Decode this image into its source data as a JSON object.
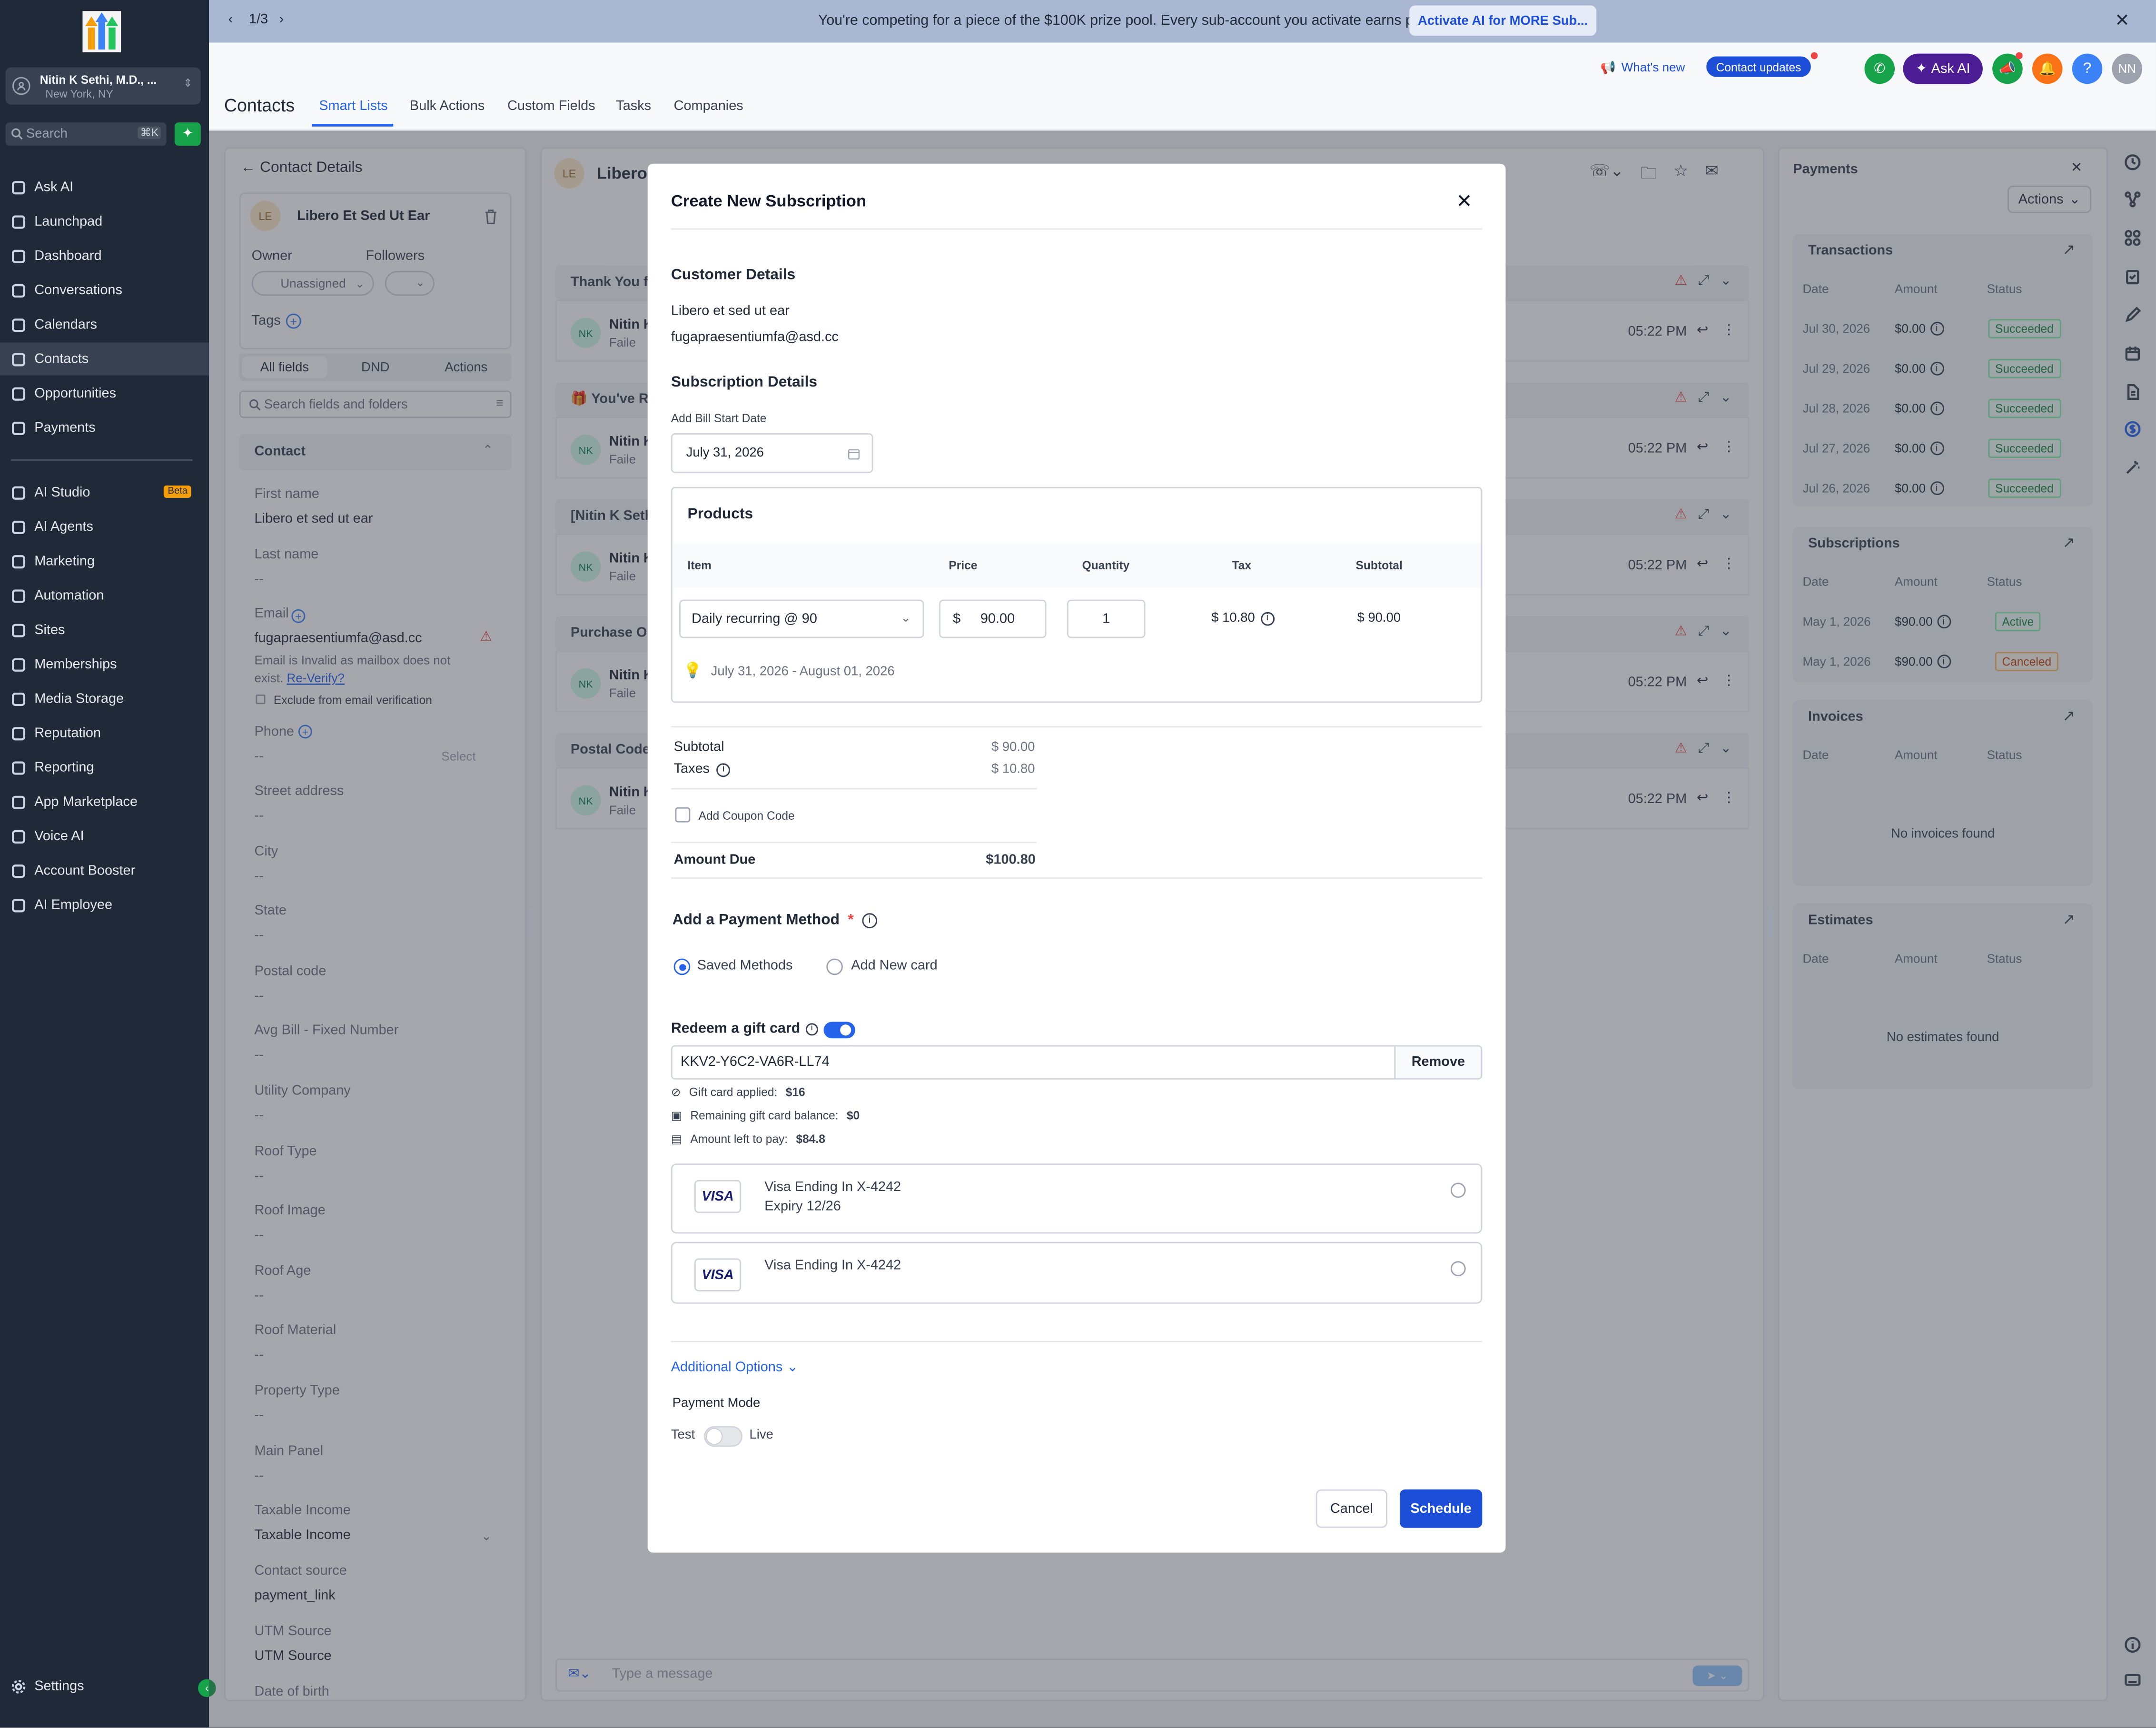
{
  "banner": {
    "page": "1/3",
    "message": "You're competing for a piece of the $100K prize pool. Every sub-account you activate earns points.",
    "cta": "Activate AI for MORE Sub..."
  },
  "account": {
    "name": "Nitin K Sethi, M.D., ...",
    "location": "New York, NY"
  },
  "search": {
    "placeholder": "Search",
    "shortcut": "⌘K"
  },
  "nav": [
    "Ask AI",
    "Launchpad",
    "Dashboard",
    "Conversations",
    "Calendars",
    "Contacts",
    "Opportunities",
    "Payments",
    "AI Studio",
    "AI Agents",
    "Marketing",
    "Automation",
    "Sites",
    "Memberships",
    "Media Storage",
    "Reputation",
    "Reporting",
    "App Marketplace",
    "Voice AI",
    "Account Booster",
    "AI Employee"
  ],
  "nav_badge": "Beta",
  "settings": "Settings",
  "header": {
    "whats_new": "What's new",
    "contact_updates": "Contact updates",
    "ask_ai": "Ask AI",
    "avatar": "NN",
    "title": "Contacts",
    "tabs": [
      "Smart Lists",
      "Bulk Actions",
      "Custom Fields",
      "Tasks",
      "Companies"
    ]
  },
  "contact": {
    "header": "Contact Details",
    "initials": "LE",
    "name": "Libero Et Sed Ut Ear",
    "owner_label": "Owner",
    "followers_label": "Followers",
    "owner_value": "Unassigned",
    "tags_label": "Tags",
    "subtabs": [
      "All fields",
      "DND",
      "Actions"
    ],
    "search_placeholder": "Search fields and folders",
    "section": "Contact",
    "fields": [
      {
        "label": "First name",
        "value": "Libero et sed ut ear"
      },
      {
        "label": "Last name",
        "value": "--"
      },
      {
        "label": "Email",
        "value": "fugapraesentiumfa@asd.cc"
      },
      {
        "label": "Phone",
        "value": "--"
      },
      {
        "label": "Street address",
        "value": "--"
      },
      {
        "label": "City",
        "value": "--"
      },
      {
        "label": "State",
        "value": "--"
      },
      {
        "label": "Postal code",
        "value": "--"
      },
      {
        "label": "Avg Bill - Fixed Number",
        "value": "--"
      },
      {
        "label": "Utility Company",
        "value": "--"
      },
      {
        "label": "Roof Type",
        "value": "--"
      },
      {
        "label": "Roof Image",
        "value": "--"
      },
      {
        "label": "Roof Age",
        "value": "--"
      },
      {
        "label": "Roof Material",
        "value": "--"
      },
      {
        "label": "Property Type",
        "value": "--"
      },
      {
        "label": "Main Panel",
        "value": "--"
      },
      {
        "label": "Taxable Income",
        "value": "Taxable Income"
      },
      {
        "label": "Contact source",
        "value": "payment_link"
      },
      {
        "label": "UTM Source",
        "value": "UTM Source"
      },
      {
        "label": "Date of birth",
        "value": ""
      }
    ],
    "email_warning": "Email is Invalid as mailbox does not exist.",
    "reverify": "Re-Verify?",
    "exclude": "Exclude from email verification",
    "phone_select": "Select"
  },
  "conversation": {
    "initials": "LE",
    "name": "Libero",
    "threads": [
      {
        "title": "Thank You fo",
        "who": "Nitin K",
        "status": "Faile",
        "time": "05:22 PM"
      },
      {
        "title": "🎁 You've Re",
        "who": "Nitin K",
        "status": "Faile",
        "time": "05:22 PM"
      },
      {
        "title": "[Nitin K Seth",
        "who": "Nitin K",
        "status": "Faile",
        "time": "05:22 PM"
      },
      {
        "title": "Purchase Or",
        "who": "Nitin K",
        "status": "Faile",
        "time": "05:22 PM"
      },
      {
        "title": "Postal Code",
        "who": "Nitin K",
        "status": "Faile",
        "time": "05:22 PM"
      }
    ],
    "avatar": "NK",
    "message_placeholder": "Type a message"
  },
  "payments": {
    "title": "Payments",
    "actions": "Actions",
    "transactions": {
      "title": "Transactions",
      "cols": [
        "Date",
        "Amount",
        "Status"
      ],
      "rows": [
        [
          "Jul 30, 2026",
          "$0.00",
          "Succeeded"
        ],
        [
          "Jul 29, 2026",
          "$0.00",
          "Succeeded"
        ],
        [
          "Jul 28, 2026",
          "$0.00",
          "Succeeded"
        ],
        [
          "Jul 27, 2026",
          "$0.00",
          "Succeeded"
        ],
        [
          "Jul 26, 2026",
          "$0.00",
          "Succeeded"
        ]
      ]
    },
    "subscriptions": {
      "title": "Subscriptions",
      "cols": [
        "Date",
        "Amount",
        "Status"
      ],
      "rows": [
        [
          "May 1, 2026",
          "$90.00",
          "Active"
        ],
        [
          "May 1, 2026",
          "$90.00",
          "Canceled"
        ]
      ]
    },
    "invoices": {
      "title": "Invoices",
      "cols": [
        "Date",
        "Amount",
        "Status"
      ],
      "empty": "No invoices found"
    },
    "estimates": {
      "title": "Estimates",
      "cols": [
        "Date",
        "Amount",
        "Status"
      ],
      "empty": "No estimates found"
    }
  },
  "modal": {
    "title": "Create New Subscription",
    "customer_heading": "Customer Details",
    "customer_name": "Libero et sed ut ear",
    "customer_email": "fugapraesentiumfa@asd.cc",
    "subscription_heading": "Subscription Details",
    "start_label": "Add Bill Start Date",
    "start_date": "July 31, 2026",
    "products_heading": "Products",
    "cols": [
      "Item",
      "Price",
      "Quantity",
      "Tax",
      "Subtotal"
    ],
    "item": "Daily recurring @ 90",
    "currency": "$",
    "price": "90.00",
    "quantity": "1",
    "tax": "$ 10.80",
    "line_subtotal": "$ 90.00",
    "period": "July 31, 2026 - August 01, 2026",
    "subtotal_label": "Subtotal",
    "subtotal": "$ 90.00",
    "taxes_label": "Taxes",
    "taxes": "$ 10.80",
    "coupon": "Add Coupon Code",
    "amount_due_label": "Amount Due",
    "amount_due": "$100.80",
    "payment_method_heading": "Add a Payment Method",
    "required": "*",
    "saved": "Saved Methods",
    "new_card": "Add New card",
    "gift_heading": "Redeem a gift card",
    "gift_code": "KKV2-Y6C2-VA6R-LL74",
    "remove": "Remove",
    "gift_applied_label": "Gift card applied:",
    "gift_applied": "$16",
    "gift_remaining_label": "Remaining gift card balance:",
    "gift_remaining": "$0",
    "left_label": "Amount left to pay:",
    "left": "$84.8",
    "cards": [
      {
        "brand": "VISA",
        "name": "Visa Ending In X-4242",
        "expiry": "Expiry 12/26"
      },
      {
        "brand": "VISA",
        "name": "Visa Ending In X-4242",
        "expiry": ""
      }
    ],
    "additional": "Additional Options",
    "payment_mode": "Payment Mode",
    "test": "Test",
    "live": "Live",
    "cancel": "Cancel",
    "schedule": "Schedule"
  },
  "colors": {
    "sidebar": "#1f2937",
    "primary": "#1d4ed8",
    "banner": "#a9b7d2"
  }
}
